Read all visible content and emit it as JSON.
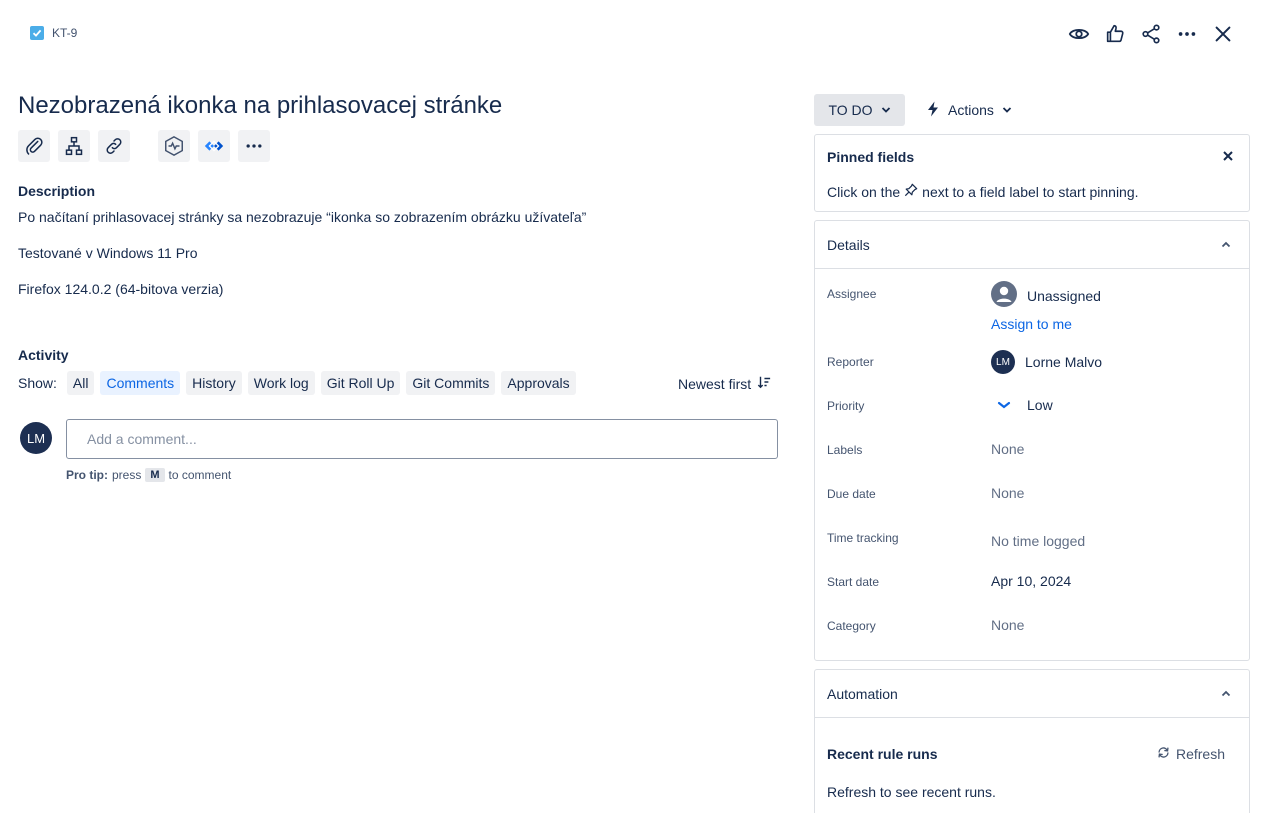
{
  "header": {
    "issue_key": "KT-9",
    "actions": [
      {
        "name": "watch-icon"
      },
      {
        "name": "like-icon"
      },
      {
        "name": "share-icon"
      },
      {
        "name": "more-icon"
      },
      {
        "name": "close-icon"
      }
    ]
  },
  "issue": {
    "title": "Nezobrazená ikonka na prihlasovacej stránke",
    "toolbar": [
      "attachment-icon",
      "child-issue-icon",
      "link-icon",
      "apps-icon",
      "integration-icon",
      "more-icon"
    ]
  },
  "description": {
    "label": "Description",
    "lines": [
      "Po načítaní prihlasovacej stránky sa nezobrazuje “ikonka so zobrazením obrázku užívateľa”",
      "Testované v Windows 11 Pro",
      "Firefox 124.0.2 (64-bitova verzia)"
    ]
  },
  "activity": {
    "label": "Activity",
    "show_label": "Show:",
    "filters": [
      "All",
      "Comments",
      "History",
      "Work log",
      "Git Roll Up",
      "Git Commits",
      "Approvals"
    ],
    "active_filter": "Comments",
    "sort_label": "Newest first",
    "avatar_initials": "LM",
    "comment_placeholder": "Add a comment...",
    "pro_tip_bold": "Pro tip:",
    "pro_tip_press": "press",
    "pro_tip_key": "M",
    "pro_tip_rest": "to comment"
  },
  "sidebar": {
    "status": "TO DO",
    "actions_label": "Actions",
    "pinned": {
      "title": "Pinned fields",
      "hint_before": "Click on the",
      "hint_after": "next to a field label to start pinning."
    },
    "details": {
      "title": "Details",
      "fields": {
        "assignee_label": "Assignee",
        "assignee_value": "Unassigned",
        "assign_to_me": "Assign to me",
        "reporter_label": "Reporter",
        "reporter_initials": "LM",
        "reporter_value": "Lorne Malvo",
        "priority_label": "Priority",
        "priority_value": "Low",
        "labels_label": "Labels",
        "labels_value": "None",
        "due_label": "Due date",
        "due_value": "None",
        "time_label": "Time tracking",
        "time_value": "No time logged",
        "start_label": "Start date",
        "start_value": "Apr 10, 2024",
        "category_label": "Category",
        "category_value": "None"
      }
    },
    "automation": {
      "title": "Automation",
      "recent_runs": "Recent rule runs",
      "refresh": "Refresh",
      "info": "Refresh to see recent runs."
    }
  },
  "colors": {
    "text": "#172b4d",
    "link": "#0c66e4",
    "active_chip_bg": "#e9f2ff",
    "avatar_bg": "#1d2f52",
    "issue_type": "#4bade8",
    "border": "#dcdfe4"
  }
}
